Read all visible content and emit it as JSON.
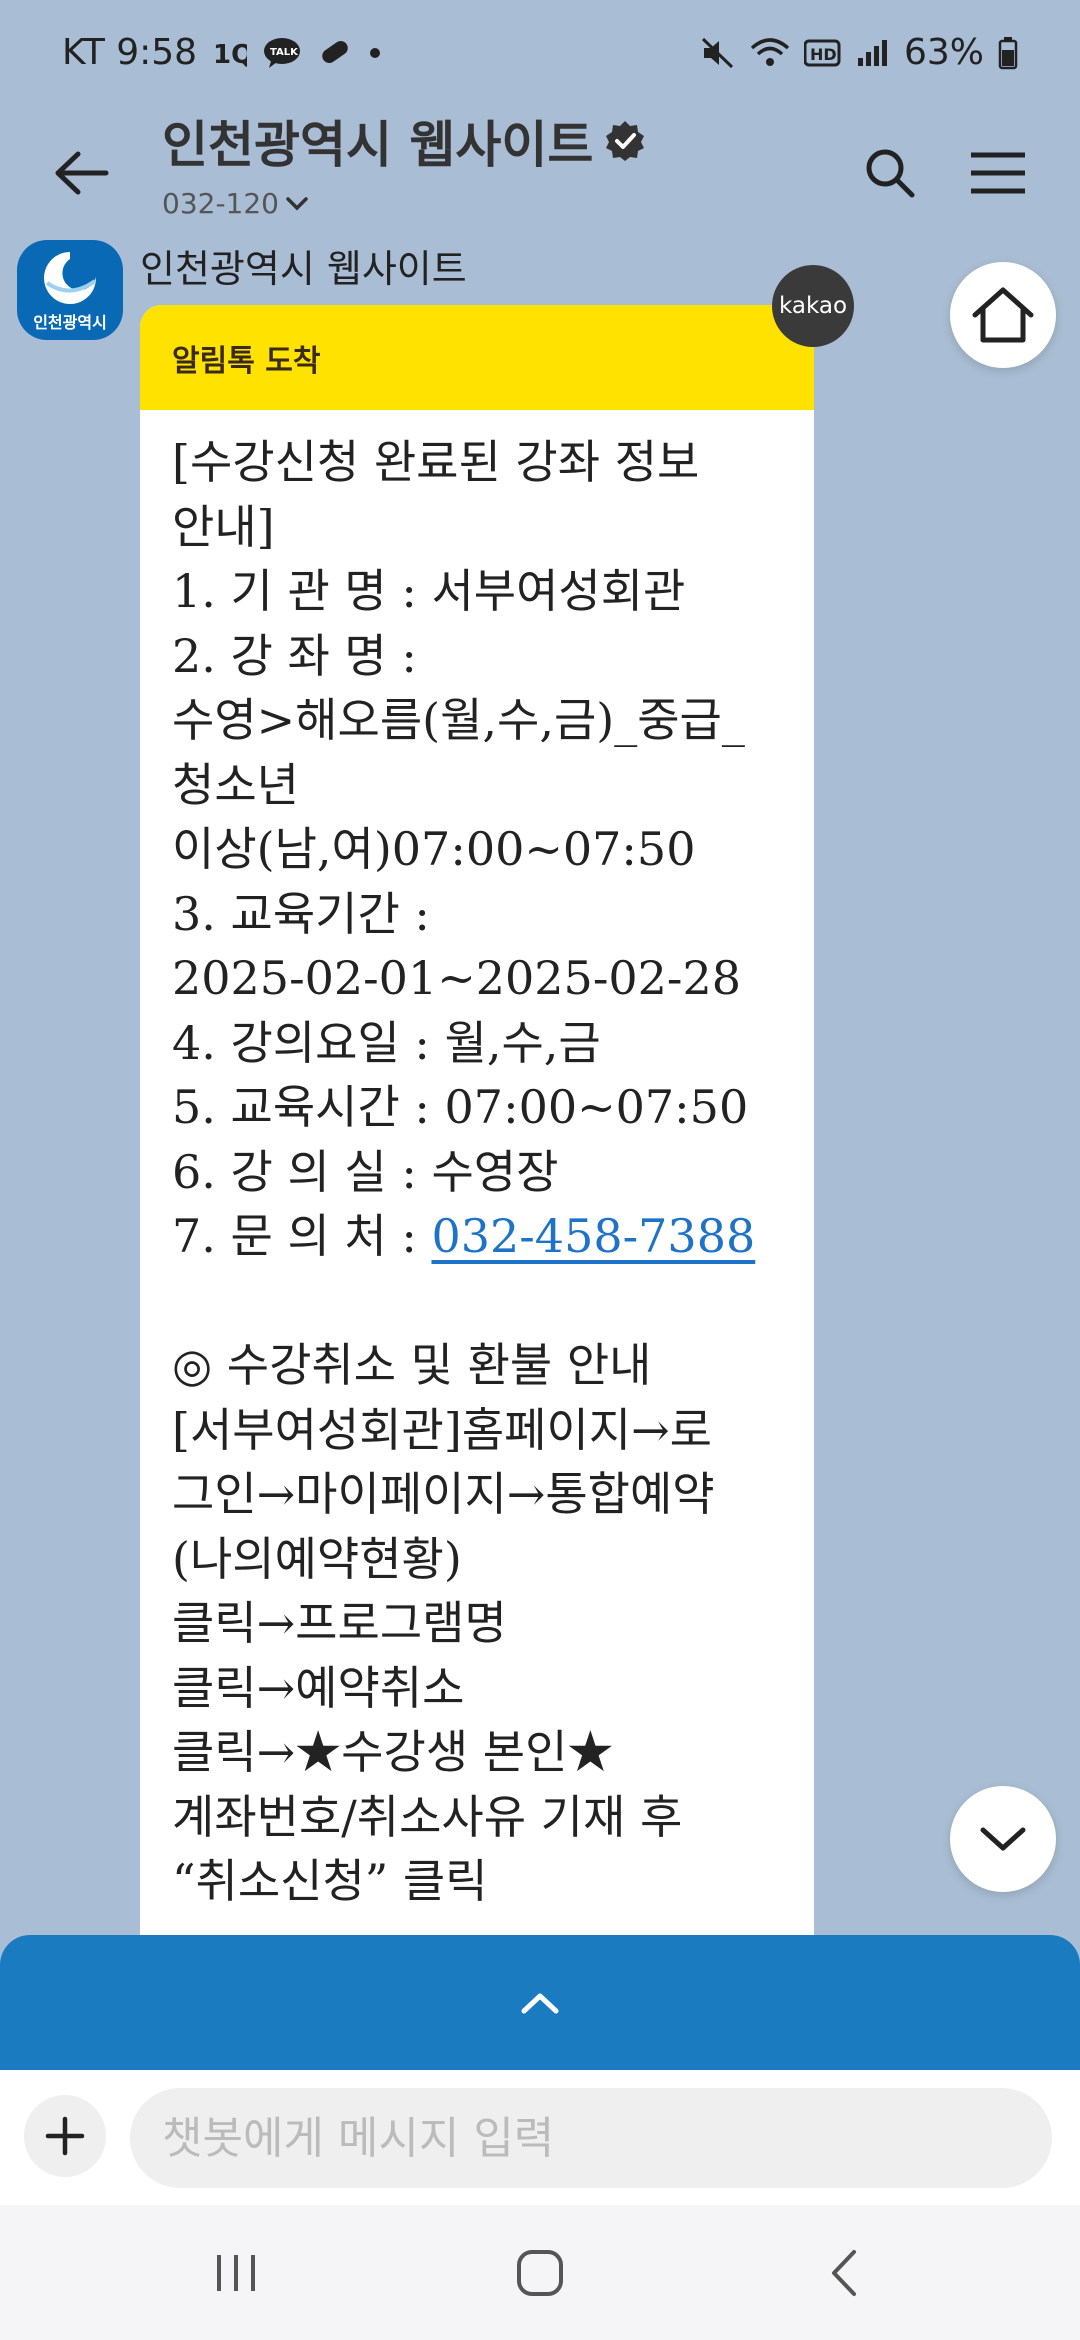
{
  "status_bar": {
    "carrier_time": "KT 9:58",
    "battery": "63%"
  },
  "header": {
    "title": "인천광역시 웹사이트",
    "subtitle": "032-120"
  },
  "chat": {
    "sender": "인천광역시 웹사이트",
    "avatar_text": "인천광역시",
    "kakao_badge": "kakao",
    "bubble_header": "알림톡 도착",
    "lines_a": [
      "[수강신청 완료된 강좌 정보",
      "안내]",
      "1. 기 관 명 : 서부여성회관",
      "2. 강 좌 명 :",
      "수영>해오름(월,수,금)_중급_",
      "청소년",
      "이상(남,여)07:00~07:50",
      "3. 교육기간 :",
      "2025-02-01~2025-02-28",
      "4. 강의요일 : 월,수,금",
      "5. 교육시간 : 07:00~07:50",
      "6. 강 의 실 : 수영장"
    ],
    "contact_label": "7. 문 의 처 :",
    "contact_phone": "032-458-7388",
    "lines_b": [
      "◎ 수강취소 및 환불 안내",
      "[서부여성회관]홈페이지→로",
      "그인→마이페이지→통합예약",
      "(나의예약현황)",
      "클릭→프로그램명",
      "클릭→예약취소",
      "클릭→★수강생 본인★",
      "계좌번호/취소사유 기재 후",
      "“취소신청” 클릭"
    ]
  },
  "input": {
    "placeholder": "챗봇에게 메시지 입력"
  },
  "icons": {
    "back": "back-arrow-icon",
    "verified": "verified-badge-icon",
    "search": "search-icon",
    "menu": "menu-icon",
    "home": "home-icon",
    "scroll_down": "chevron-down-icon",
    "expand": "chevron-up-icon",
    "plus": "plus-icon"
  },
  "colors": {
    "chat_background": "#a9bed4",
    "bubble_header": "#ffe200",
    "bottom_panel": "#1b7bc1",
    "link": "#1e73c8"
  }
}
